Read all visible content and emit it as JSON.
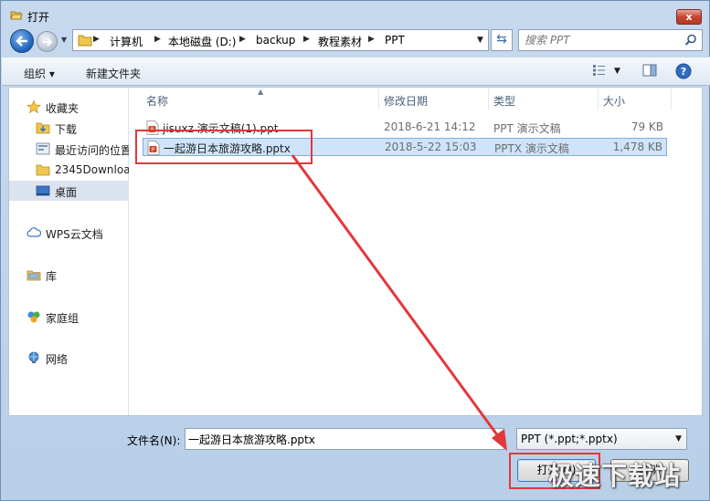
{
  "window": {
    "title": "打开"
  },
  "title_bar": {
    "close_glyph": "x"
  },
  "address": {
    "crumbs": [
      "计算机",
      "本地磁盘 (D:)",
      "backup",
      "教程素材",
      "PPT"
    ],
    "search_placeholder": "搜索 PPT"
  },
  "toolbar": {
    "organize": "组织 ▾",
    "new_folder": "新建文件夹"
  },
  "nav": {
    "items": [
      {
        "label": "收藏夹",
        "icon": "star-icon"
      },
      {
        "label": "下载",
        "icon": "download-folder-icon"
      },
      {
        "label": "最近访问的位置",
        "icon": "recent-places-icon"
      },
      {
        "label": "2345Downloa",
        "icon": "folder-icon"
      },
      {
        "label": "桌面",
        "icon": "desktop-icon"
      },
      {
        "label": "WPS云文档",
        "icon": "cloud-icon"
      },
      {
        "label": "库",
        "icon": "library-icon"
      },
      {
        "label": "家庭组",
        "icon": "homegroup-icon"
      },
      {
        "label": "网络",
        "icon": "network-icon"
      }
    ]
  },
  "columns": {
    "name": "名称",
    "date": "修改日期",
    "type": "类型",
    "size": "大小"
  },
  "files": [
    {
      "name": "jisuxz 演示文稿(1).ppt",
      "date": "2018-6-21 14:12",
      "type": "PPT 演示文稿",
      "size": "79 KB"
    },
    {
      "name": "一起游日本旅游攻略.pptx",
      "date": "2018-5-22 15:03",
      "type": "PPTX 演示文稿",
      "size": "1,478 KB"
    }
  ],
  "footer": {
    "filename_label": "文件名(N):",
    "filename_value": "一起游日本旅游攻略.pptx",
    "filter_value": "PPT (*.ppt;*.pptx)",
    "open_label": "打开(O)",
    "cancel_label": "取消"
  },
  "watermark": "极速下载站",
  "colors": {
    "annotation": "#e2373b",
    "selection": "#cde4fb",
    "window_frame": "#b9cfe8"
  }
}
